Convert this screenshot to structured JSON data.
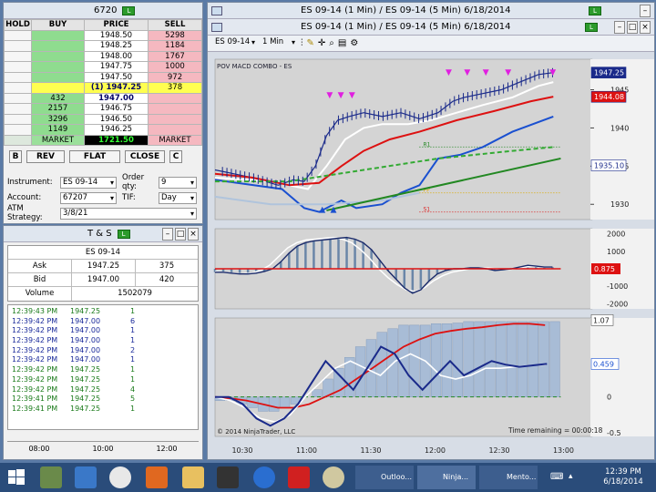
{
  "dom_window": {
    "title": "6720",
    "headers": {
      "hold": "HOLD",
      "buy": "BUY",
      "price": "PRICE",
      "sell": "SELL"
    },
    "rows": [
      {
        "buy": "",
        "price": "1948.50",
        "sell": "5298"
      },
      {
        "buy": "",
        "price": "1948.25",
        "sell": "1184"
      },
      {
        "buy": "",
        "price": "1948.00",
        "sell": "1767"
      },
      {
        "buy": "",
        "price": "1947.75",
        "sell": "1000"
      },
      {
        "buy": "",
        "price": "1947.50",
        "sell": "972"
      },
      {
        "buy": "",
        "price": "(1) 1947.25",
        "sell": "378",
        "current": true
      },
      {
        "buy": "432",
        "price": "1947.00",
        "sell": ""
      },
      {
        "buy": "2157",
        "price": "1946.75",
        "sell": ""
      },
      {
        "buy": "3296",
        "price": "1946.50",
        "sell": ""
      },
      {
        "buy": "1149",
        "price": "1946.25",
        "sell": ""
      }
    ],
    "market_row": {
      "left": "MARKET",
      "mid": "1721.50",
      "right": "MARKET"
    },
    "buttons": {
      "b": "B",
      "rev": "REV",
      "flat": "FLAT",
      "close": "CLOSE",
      "c": "C"
    },
    "form": {
      "instrument_label": "Instrument:",
      "instrument": "ES 09-14",
      "order_qty_label": "Order qty:",
      "order_qty": "9",
      "account_label": "Account:",
      "account": "67207",
      "tif_label": "TIF:",
      "tif": "Day",
      "atm_label": "ATM Strategy:",
      "atm": "3/8/21"
    }
  },
  "ts_window": {
    "title": "T & S",
    "instrument": "ES 09-14",
    "ask_label": "Ask",
    "ask_price": "1947.25",
    "ask_size": "375",
    "bid_label": "Bid",
    "bid_price": "1947.00",
    "bid_size": "420",
    "volume_label": "Volume",
    "volume": "1502079",
    "trades": [
      {
        "time": "12:39:43 PM",
        "price": "1947.25",
        "size": "1",
        "side": "ask"
      },
      {
        "time": "12:39:42 PM",
        "price": "1947.00",
        "size": "6",
        "side": "bid"
      },
      {
        "time": "12:39:42 PM",
        "price": "1947.00",
        "size": "1",
        "side": "bid"
      },
      {
        "time": "12:39:42 PM",
        "price": "1947.00",
        "size": "1",
        "side": "bid"
      },
      {
        "time": "12:39:42 PM",
        "price": "1947.00",
        "size": "2",
        "side": "bid"
      },
      {
        "time": "12:39:42 PM",
        "price": "1947.00",
        "size": "1",
        "side": "bid"
      },
      {
        "time": "12:39:42 PM",
        "price": "1947.25",
        "size": "1",
        "side": "ask"
      },
      {
        "time": "12:39:42 PM",
        "price": "1947.25",
        "size": "1",
        "side": "ask"
      },
      {
        "time": "12:39:42 PM",
        "price": "1947.25",
        "size": "4",
        "side": "ask"
      },
      {
        "time": "12:39:41 PM",
        "price": "1947.25",
        "size": "5",
        "side": "ask"
      },
      {
        "time": "12:39:41 PM",
        "price": "1947.25",
        "size": "1",
        "side": "ask"
      }
    ],
    "time_axis": [
      "08:00",
      "10:00",
      "12:00"
    ]
  },
  "chart_window": {
    "outer_title": "ES 09-14 (1 Min) / ES 09-14 (5 Min)  6/18/2014",
    "inner_title": "ES 09-14 (1 Min) / ES 09-14 (5 Min)  6/18/2014",
    "toolbar": {
      "instrument": "ES 09-14",
      "interval": "1 Min"
    },
    "panel_label": "POV MACD COMBO - ES",
    "copyright": "© 2014 NinjaTrader, LLC",
    "time_remaining": "Time remaining = 00:00:18",
    "level_labels": {
      "r1": "R1",
      "pp": "PP",
      "s1": "S1"
    }
  },
  "chart_data": [
    {
      "type": "line",
      "name": "price",
      "x": [
        "10:30",
        "11:00",
        "11:30",
        "12:00",
        "12:30",
        "13:00"
      ],
      "y_ticks": [
        1930,
        1935,
        1940,
        1945
      ],
      "ylim": [
        1928,
        1949
      ],
      "price_badges": {
        "last": "1947.25",
        "red_line": "1944.08",
        "blue_line": "1935.10"
      },
      "series": [
        {
          "color": "#1a2a8a",
          "points": [
            [
              0,
              1934.5
            ],
            [
              0.05,
              1934.0
            ],
            [
              0.1,
              1933.5
            ],
            [
              0.17,
              1932.5
            ],
            [
              0.21,
              1933.2
            ],
            [
              0.24,
              1933.0
            ],
            [
              0.27,
              1935.0
            ],
            [
              0.3,
              1939.0
            ],
            [
              0.33,
              1941.0
            ],
            [
              0.36,
              1941.5
            ],
            [
              0.4,
              1942.0
            ],
            [
              0.45,
              1941.5
            ],
            [
              0.5,
              1942.0
            ],
            [
              0.55,
              1941.2
            ],
            [
              0.6,
              1942.0
            ],
            [
              0.64,
              1943.5
            ],
            [
              0.67,
              1944.0
            ],
            [
              0.72,
              1944.5
            ],
            [
              0.77,
              1945.0
            ],
            [
              0.82,
              1946.0
            ],
            [
              0.87,
              1947.0
            ],
            [
              0.91,
              1947.25
            ]
          ]
        },
        {
          "color": "#ffffff",
          "points": [
            [
              0,
              1933.5
            ],
            [
              0.15,
              1933.0
            ],
            [
              0.25,
              1932.0
            ],
            [
              0.3,
              1935.0
            ],
            [
              0.35,
              1938.5
            ],
            [
              0.4,
              1940.0
            ],
            [
              0.45,
              1940.5
            ],
            [
              0.52,
              1940.5
            ],
            [
              0.58,
              1941.0
            ],
            [
              0.65,
              1942.0
            ],
            [
              0.72,
              1943.0
            ],
            [
              0.8,
              1944.0
            ],
            [
              0.87,
              1945.5
            ],
            [
              0.91,
              1946.0
            ]
          ]
        },
        {
          "color": "#dd1111",
          "points": [
            [
              0,
              1934.0
            ],
            [
              0.1,
              1933.5
            ],
            [
              0.2,
              1932.5
            ],
            [
              0.28,
              1932.8
            ],
            [
              0.34,
              1935.0
            ],
            [
              0.4,
              1937.0
            ],
            [
              0.47,
              1938.5
            ],
            [
              0.55,
              1939.5
            ],
            [
              0.65,
              1941.0
            ],
            [
              0.75,
              1942.2
            ],
            [
              0.85,
              1943.5
            ],
            [
              0.91,
              1944.1
            ]
          ]
        },
        {
          "color": "#1a50d0",
          "points": [
            [
              0,
              1933.2
            ],
            [
              0.18,
              1932.0
            ],
            [
              0.24,
              1929.5
            ],
            [
              0.28,
              1929.0
            ],
            [
              0.34,
              1930.5
            ],
            [
              0.38,
              1929.5
            ],
            [
              0.45,
              1930.0
            ],
            [
              0.5,
              1931.5
            ],
            [
              0.55,
              1932.5
            ],
            [
              0.6,
              1936.0
            ],
            [
              0.66,
              1936.5
            ],
            [
              0.72,
              1937.5
            ],
            [
              0.8,
              1939.5
            ],
            [
              0.91,
              1941.5
            ]
          ]
        },
        {
          "color": "#33aa33",
          "dashed": true,
          "points": [
            [
              0,
              1933.0
            ],
            [
              0.2,
              1933.0
            ],
            [
              0.4,
              1934.5
            ],
            [
              0.6,
              1936.0
            ],
            [
              0.8,
              1937.0
            ],
            [
              0.91,
              1937.5
            ]
          ]
        },
        {
          "color": "#b0c4dc",
          "points": [
            [
              0,
              1931.0
            ],
            [
              0.15,
              1930.0
            ],
            [
              0.3,
              1930.0
            ],
            [
              0.45,
              1930.5
            ],
            [
              0.55,
              1931.5
            ]
          ]
        }
      ]
    },
    {
      "type": "area",
      "name": "macd",
      "y_ticks": [
        2000,
        1000,
        0,
        -1000,
        -2000
      ],
      "ylim": [
        -2300,
        2300
      ],
      "badge": "0.875",
      "histogram": [
        -200,
        -200,
        -250,
        -300,
        -300,
        -250,
        -150,
        0,
        400,
        900,
        1300,
        1500,
        1600,
        1650,
        1700,
        1750,
        1800,
        1700,
        1500,
        1100,
        500,
        -100,
        -600,
        -1100,
        -1400,
        -1200,
        -700,
        -300,
        -100,
        0,
        0,
        50,
        50,
        0,
        -100,
        -50,
        0,
        100,
        200,
        150,
        100,
        100
      ],
      "white_line": [
        -150,
        -200,
        -250,
        -300,
        -250,
        -100,
        200,
        700,
        1200,
        1500,
        1650,
        1700,
        1750,
        1800,
        1700,
        1500,
        1100,
        600,
        0,
        -500,
        -900,
        -1200,
        -1300,
        -1100,
        -700,
        -400,
        -200,
        -100,
        0,
        0,
        50,
        0,
        -50,
        0,
        100,
        150,
        100,
        100
      ]
    },
    {
      "type": "area",
      "name": "macd_combo",
      "y_ticks": [
        1.07,
        0.459,
        0,
        -0.5
      ],
      "ylim": [
        -0.55,
        1.1
      ],
      "badge_top": "1.07",
      "badge_mid": "0.459",
      "bars": [
        -0.05,
        -0.05,
        -0.1,
        -0.15,
        -0.2,
        -0.2,
        -0.15,
        -0.1,
        0,
        0.1,
        0.25,
        0.4,
        0.55,
        0.7,
        0.8,
        0.9,
        0.95,
        1.0,
        1.0,
        1.0,
        1.02,
        1.02,
        1.03,
        1.05,
        1.05,
        1.05,
        1.05,
        1.05,
        1.05,
        1.05,
        1.05,
        1.05
      ],
      "dark_line": [
        0,
        0,
        -0.1,
        -0.3,
        -0.4,
        -0.3,
        -0.1,
        0.2,
        0.5,
        0.3,
        0.1,
        0.4,
        0.7,
        0.6,
        0.3,
        0.1,
        0.3,
        0.5,
        0.3,
        0.4,
        0.5,
        0.45,
        0.42,
        0.44,
        0.46
      ],
      "white_line": [
        0,
        -0.05,
        -0.15,
        -0.3,
        -0.35,
        -0.25,
        0,
        0.2,
        0.4,
        0.5,
        0.4,
        0.3,
        0.5,
        0.6,
        0.5,
        0.3,
        0.25,
        0.3,
        0.4,
        0.4,
        0.42,
        0.44,
        0.45
      ],
      "red_line": [
        0,
        -0.02,
        -0.05,
        -0.1,
        -0.15,
        -0.15,
        -0.1,
        0,
        0.1,
        0.25,
        0.4,
        0.55,
        0.7,
        0.8,
        0.88,
        0.92,
        0.95,
        0.97,
        1.0,
        1.02,
        1.02,
        1.0
      ]
    }
  ],
  "taskbar": {
    "clock_time": "12:39 PM",
    "clock_date": "6/18/2014",
    "apps": [
      "Outloo...",
      "Ninja...",
      "Mento..."
    ]
  }
}
